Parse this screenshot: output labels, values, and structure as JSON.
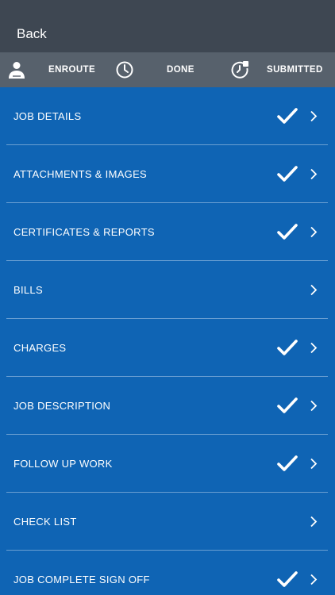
{
  "header": {
    "back_label": "Back"
  },
  "status": {
    "enroute_label": "ENROUTE",
    "done_label": "DONE",
    "submitted_label": "SUBMITTED"
  },
  "menu": {
    "items": [
      {
        "label": "JOB DETAILS",
        "checked": true
      },
      {
        "label": "ATTACHMENTS & IMAGES",
        "checked": true
      },
      {
        "label": "CERTIFICATES & REPORTS",
        "checked": true
      },
      {
        "label": "BILLS",
        "checked": false
      },
      {
        "label": "CHARGES",
        "checked": true
      },
      {
        "label": "JOB DESCRIPTION",
        "checked": true
      },
      {
        "label": "FOLLOW UP WORK",
        "checked": true
      },
      {
        "label": "CHECK LIST",
        "checked": false
      },
      {
        "label": "JOB COMPLETE SIGN OFF",
        "checked": true
      }
    ]
  },
  "colors": {
    "topbar": "#3e4752",
    "statusbar": "#57616c",
    "list_background": "#0f64b4",
    "divider": "#6a9fd2"
  }
}
